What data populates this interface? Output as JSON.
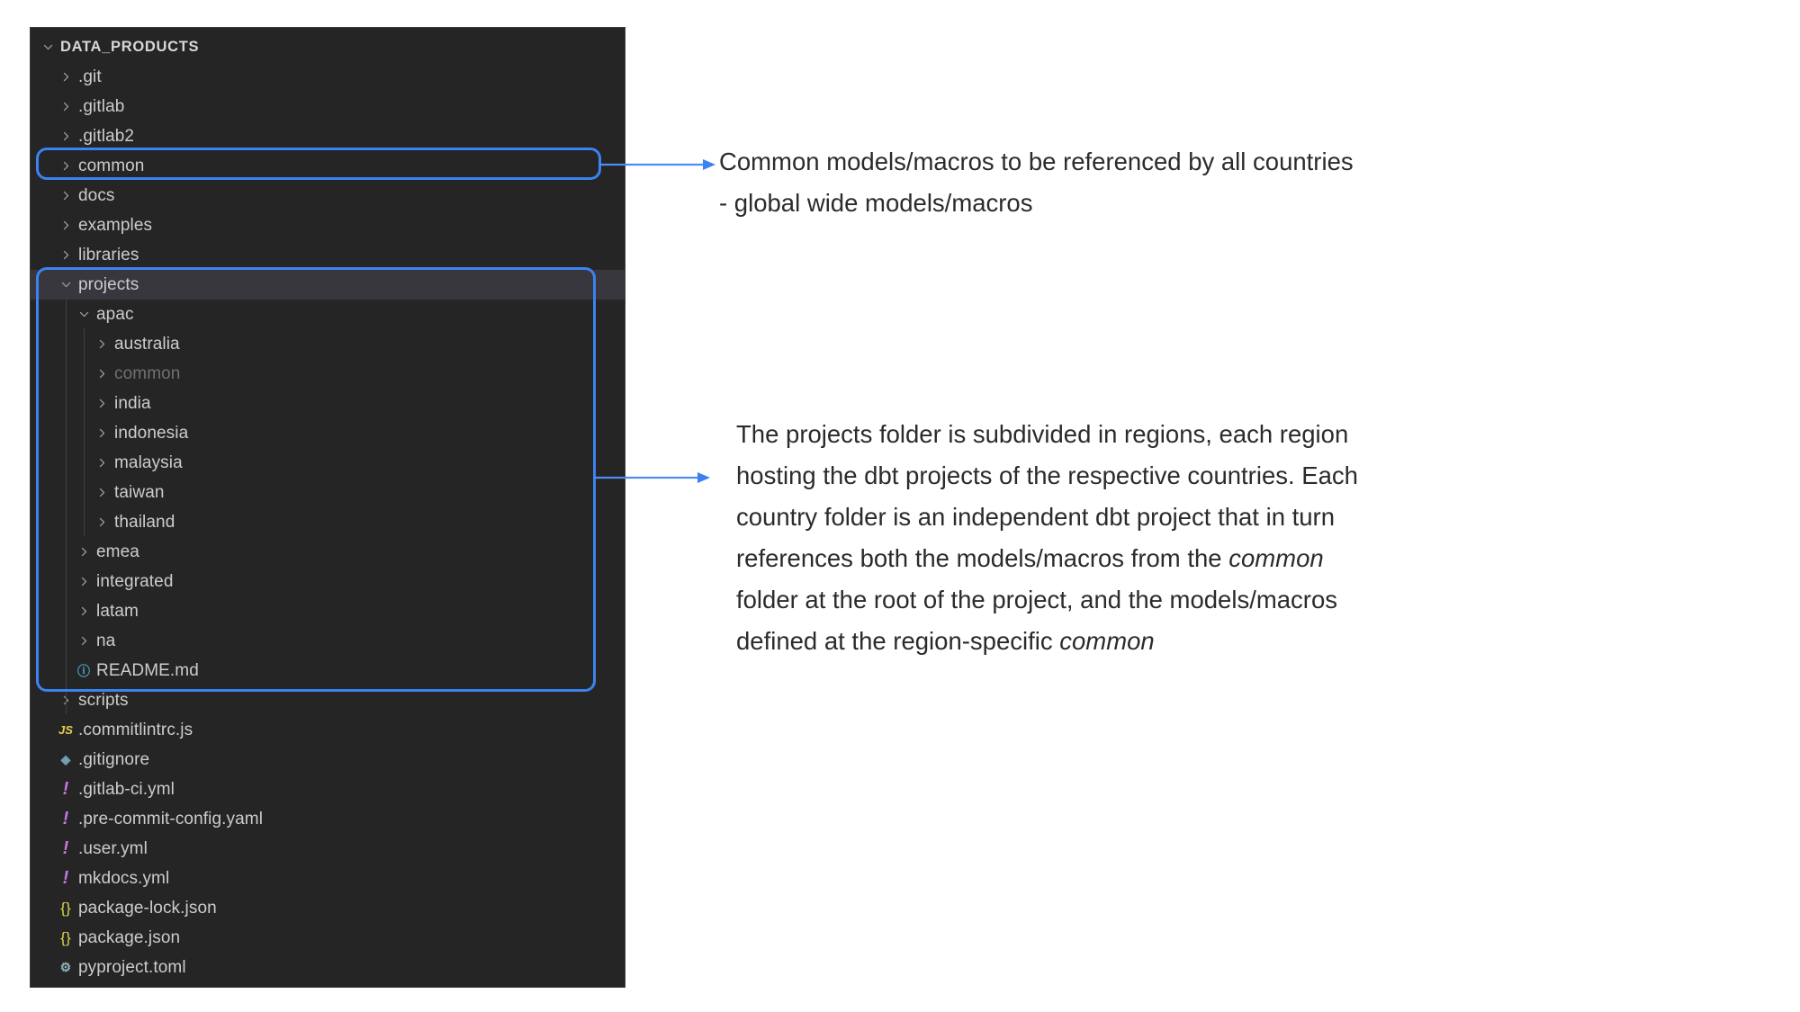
{
  "explorer": {
    "root_label": "DATA_PRODUCTS",
    "items": [
      {
        "label": "DATA_PRODUCTS",
        "type": "root",
        "indent": 0,
        "state": "expanded",
        "icon": "chevron-down-icon",
        "dimmed": false,
        "selected": false
      },
      {
        "label": ".git",
        "type": "folder",
        "indent": 1,
        "state": "collapsed",
        "icon": "chevron-right-icon",
        "dimmed": false,
        "selected": false
      },
      {
        "label": ".gitlab",
        "type": "folder",
        "indent": 1,
        "state": "collapsed",
        "icon": "chevron-right-icon",
        "dimmed": false,
        "selected": false
      },
      {
        "label": ".gitlab2",
        "type": "folder",
        "indent": 1,
        "state": "collapsed",
        "icon": "chevron-right-icon",
        "dimmed": false,
        "selected": false
      },
      {
        "label": "common",
        "type": "folder",
        "indent": 1,
        "state": "collapsed",
        "icon": "chevron-right-icon",
        "dimmed": false,
        "selected": false
      },
      {
        "label": "docs",
        "type": "folder",
        "indent": 1,
        "state": "collapsed",
        "icon": "chevron-right-icon",
        "dimmed": false,
        "selected": false
      },
      {
        "label": "examples",
        "type": "folder",
        "indent": 1,
        "state": "collapsed",
        "icon": "chevron-right-icon",
        "dimmed": false,
        "selected": false
      },
      {
        "label": "libraries",
        "type": "folder",
        "indent": 1,
        "state": "collapsed",
        "icon": "chevron-right-icon",
        "dimmed": false,
        "selected": false
      },
      {
        "label": "projects",
        "type": "folder",
        "indent": 1,
        "state": "expanded",
        "icon": "chevron-down-icon",
        "dimmed": false,
        "selected": true
      },
      {
        "label": "apac",
        "type": "folder",
        "indent": 2,
        "state": "expanded",
        "icon": "chevron-down-icon",
        "dimmed": false,
        "selected": false
      },
      {
        "label": "australia",
        "type": "folder",
        "indent": 3,
        "state": "collapsed",
        "icon": "chevron-right-icon",
        "dimmed": false,
        "selected": false
      },
      {
        "label": "common",
        "type": "folder",
        "indent": 3,
        "state": "collapsed",
        "icon": "chevron-right-icon",
        "dimmed": true,
        "selected": false
      },
      {
        "label": "india",
        "type": "folder",
        "indent": 3,
        "state": "collapsed",
        "icon": "chevron-right-icon",
        "dimmed": false,
        "selected": false
      },
      {
        "label": "indonesia",
        "type": "folder",
        "indent": 3,
        "state": "collapsed",
        "icon": "chevron-right-icon",
        "dimmed": false,
        "selected": false
      },
      {
        "label": "malaysia",
        "type": "folder",
        "indent": 3,
        "state": "collapsed",
        "icon": "chevron-right-icon",
        "dimmed": false,
        "selected": false
      },
      {
        "label": "taiwan",
        "type": "folder",
        "indent": 3,
        "state": "collapsed",
        "icon": "chevron-right-icon",
        "dimmed": false,
        "selected": false
      },
      {
        "label": "thailand",
        "type": "folder",
        "indent": 3,
        "state": "collapsed",
        "icon": "chevron-right-icon",
        "dimmed": false,
        "selected": false
      },
      {
        "label": "emea",
        "type": "folder",
        "indent": 2,
        "state": "collapsed",
        "icon": "chevron-right-icon",
        "dimmed": false,
        "selected": false
      },
      {
        "label": "integrated",
        "type": "folder",
        "indent": 2,
        "state": "collapsed",
        "icon": "chevron-right-icon",
        "dimmed": false,
        "selected": false
      },
      {
        "label": "latam",
        "type": "folder",
        "indent": 2,
        "state": "collapsed",
        "icon": "chevron-right-icon",
        "dimmed": false,
        "selected": false
      },
      {
        "label": "na",
        "type": "folder",
        "indent": 2,
        "state": "collapsed",
        "icon": "chevron-right-icon",
        "dimmed": false,
        "selected": false
      },
      {
        "label": "README.md",
        "type": "file",
        "indent": 2,
        "state": "",
        "icon": "markdown-info-icon",
        "icon_class": "md",
        "icon_glyph": "ⓘ",
        "dimmed": false,
        "selected": false
      },
      {
        "label": "scripts",
        "type": "folder",
        "indent": 1,
        "state": "collapsed",
        "icon": "chevron-right-icon",
        "dimmed": false,
        "selected": false
      },
      {
        "label": ".commitlintrc.js",
        "type": "file",
        "indent": 1,
        "state": "",
        "icon": "javascript-file-icon",
        "icon_class": "js",
        "icon_glyph": "JS",
        "dimmed": false,
        "selected": false
      },
      {
        "label": ".gitignore",
        "type": "file",
        "indent": 1,
        "state": "",
        "icon": "gitignore-file-icon",
        "icon_class": "gitignore",
        "icon_glyph": "◆",
        "dimmed": false,
        "selected": false
      },
      {
        "label": ".gitlab-ci.yml",
        "type": "file",
        "indent": 1,
        "state": "",
        "icon": "yaml-file-icon",
        "icon_class": "yml",
        "icon_glyph": "!",
        "dimmed": false,
        "selected": false
      },
      {
        "label": ".pre-commit-config.yaml",
        "type": "file",
        "indent": 1,
        "state": "",
        "icon": "yaml-file-icon",
        "icon_class": "yml",
        "icon_glyph": "!",
        "dimmed": false,
        "selected": false
      },
      {
        "label": ".user.yml",
        "type": "file",
        "indent": 1,
        "state": "",
        "icon": "yaml-file-icon",
        "icon_class": "yml",
        "icon_glyph": "!",
        "dimmed": false,
        "selected": false
      },
      {
        "label": "mkdocs.yml",
        "type": "file",
        "indent": 1,
        "state": "",
        "icon": "yaml-file-icon",
        "icon_class": "yml",
        "icon_glyph": "!",
        "dimmed": false,
        "selected": false
      },
      {
        "label": "package-lock.json",
        "type": "file",
        "indent": 1,
        "state": "",
        "icon": "json-file-icon",
        "icon_class": "json",
        "icon_glyph": "{}",
        "dimmed": false,
        "selected": false
      },
      {
        "label": "package.json",
        "type": "file",
        "indent": 1,
        "state": "",
        "icon": "json-file-icon",
        "icon_class": "json",
        "icon_glyph": "{}",
        "dimmed": false,
        "selected": false
      },
      {
        "label": "pyproject.toml",
        "type": "file",
        "indent": 1,
        "state": "",
        "icon": "toml-gear-icon",
        "icon_class": "toml",
        "icon_glyph": "⚙",
        "dimmed": false,
        "selected": false
      }
    ]
  },
  "annotations": [
    {
      "id": "common",
      "target": "common",
      "text": "Common models/macros to be referenced by all countries - global wide models/macros"
    },
    {
      "id": "projects",
      "target": "projects",
      "text_part_1": "The projects folder is subdivided in regions, each region hosting the dbt projects of the respective countries. Each country folder is an independent dbt project that in turn references both the models/macros from the ",
      "emphasis_1": "common",
      "text_part_2": " folder at the root of the project, and the models/macros defined at the region-specific ",
      "emphasis_2": "common"
    }
  ],
  "colors": {
    "panel_background": "#252526",
    "selected_row": "#37373d",
    "text": "#cccccc",
    "dimmed_text": "#707070",
    "highlight_border": "#3c82f0",
    "annotation_text": "#2b2b2b",
    "page_background": "#ffffff"
  }
}
